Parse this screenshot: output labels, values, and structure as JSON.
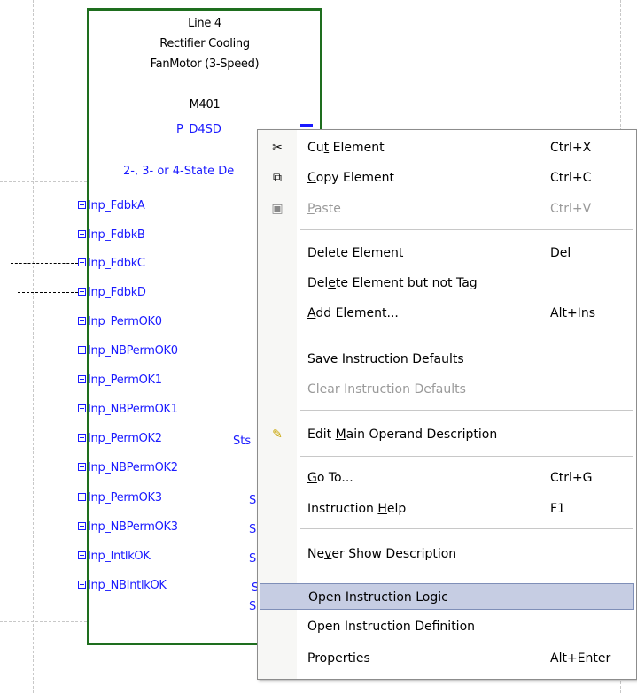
{
  "block": {
    "title_line1": "Line 4",
    "title_line2": "Rectifier Cooling",
    "title_line3": "FanMotor (3-Speed)",
    "tag": "M401",
    "instruction": "P_D4SD",
    "description": "2-, 3- or 4-State De"
  },
  "pins": [
    "Inp_FdbkA",
    "Inp_FdbkB",
    "Inp_FdbkC",
    "Inp_FdbkD",
    "Inp_PermOK0",
    "Inp_NBPermOK0",
    "Inp_PermOK1",
    "Inp_NBPermOK1",
    "Inp_PermOK2",
    "Inp_NBPermOK2",
    "Inp_PermOK3",
    "Inp_NBPermOK3",
    "Inp_IntlkOK",
    "Inp_NBIntlkOK"
  ],
  "output_fragments": [
    "Sts",
    "S",
    "S",
    "S",
    "S",
    "S"
  ],
  "menu": {
    "cut": {
      "label_pre": "Cu",
      "label_u": "t",
      "label_post": " Element",
      "shortcut": "Ctrl+X",
      "icon": "scissors-icon"
    },
    "copy": {
      "label_pre": "",
      "label_u": "C",
      "label_post": "opy Element",
      "shortcut": "Ctrl+C",
      "icon": "copy-icon"
    },
    "paste": {
      "label_pre": "",
      "label_u": "P",
      "label_post": "aste",
      "shortcut": "Ctrl+V",
      "icon": "paste-icon"
    },
    "delete": {
      "label_pre": "",
      "label_u": "D",
      "label_post": "elete Element",
      "shortcut": "Del"
    },
    "delete_not_tag": {
      "label_pre": "Del",
      "label_u": "e",
      "label_post": "te Element but not Tag"
    },
    "add": {
      "label_pre": "",
      "label_u": "A",
      "label_post": "dd Element...",
      "shortcut": "Alt+Ins"
    },
    "save_defaults": {
      "label": "Save Instruction Defaults"
    },
    "clear_defaults": {
      "label": "Clear Instruction Defaults"
    },
    "edit_desc": {
      "label_pre": "Edit ",
      "label_u": "M",
      "label_post": "ain Operand Description",
      "icon": "pencil-icon"
    },
    "goto": {
      "label_pre": "",
      "label_u": "G",
      "label_post": "o To...",
      "shortcut": "Ctrl+G"
    },
    "help": {
      "label_pre": "Instruction ",
      "label_u": "H",
      "label_post": "elp",
      "shortcut": "F1"
    },
    "never_show": {
      "label_pre": "Ne",
      "label_u": "v",
      "label_post": "er Show Description"
    },
    "open_logic": {
      "label": "Open Instruction Logic"
    },
    "open_def": {
      "label": "Open Instruction Definition"
    },
    "properties": {
      "label": "Properties",
      "shortcut": "Alt+Enter"
    }
  }
}
